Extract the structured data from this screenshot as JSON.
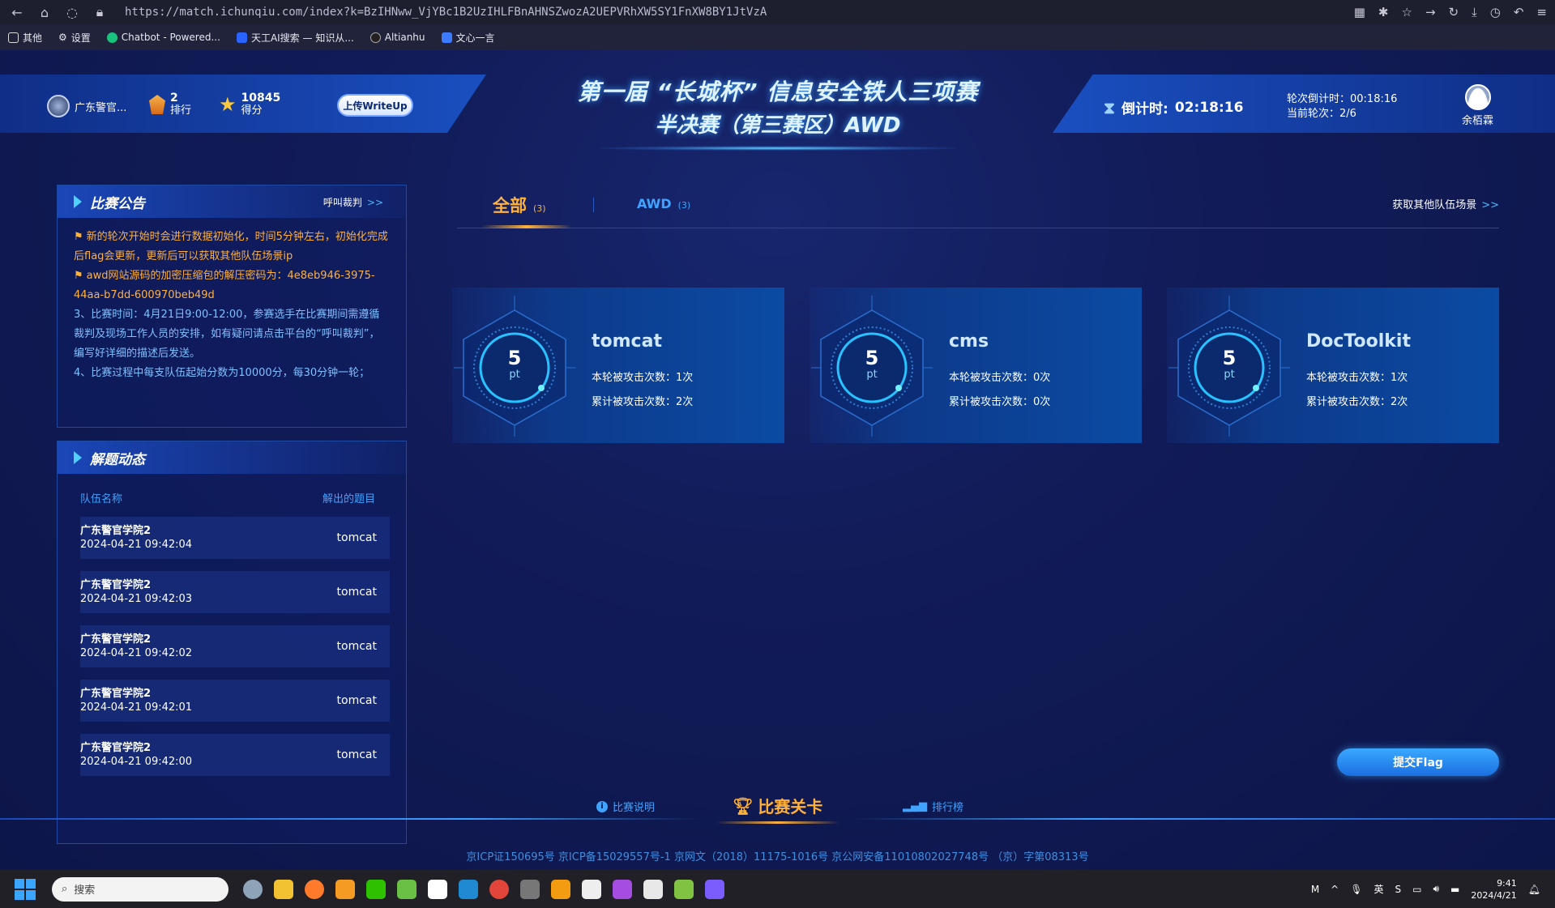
{
  "browser": {
    "url": "https://match.ichunqiu.com/index?k=BzIHNww_VjYBc1B2UzIHLFBnAHNSZwozA2UEPVRhXW5SY1FnXW8BY1JtVzA",
    "bookmarks": [
      "其他",
      "设置",
      "Chatbot - Powered...",
      "天工AI搜索 — 知识从...",
      "Altianhu",
      "文心一言"
    ]
  },
  "header": {
    "team_name": "广东警官...",
    "rank_value": "2",
    "rank_label": "排行",
    "score_value": "10845",
    "score_label": "得分",
    "writeup_button": "上传WriteUp",
    "title_line1": "第一届 “长城杯” 信息安全铁人三项赛",
    "title_line2": "半决赛（第三赛区）AWD",
    "countdown_label": "倒计时:",
    "countdown_value": "02:18:16",
    "round_countdown": "轮次倒计时：00:18:16",
    "current_round": "当前轮次：2/6",
    "username": "余栢霖"
  },
  "announcement": {
    "title": "比赛公告",
    "link": "呼叫裁判",
    "link_arrow": ">>",
    "items": [
      "新的轮次开始时会进行数据初始化，时间5分钟左右，初始化完成后flag会更新，更新后可以获取其他队伍场景ip",
      "awd网站源码的加密压缩包的解压密码为：4e8eb946-3975-44aa-b7dd-600970beb49d",
      "3、比赛时间：4月21日9:00-12:00，参赛选手在比赛期间需遵循裁判及现场工作人员的安排，如有疑问请点击平台的“呼叫裁判”，编写好详细的描述后发送。",
      "4、比赛过程中每支队伍起始分数为10000分，每30分钟一轮；"
    ]
  },
  "solves": {
    "title": "解题动态",
    "col_team": "队伍名称",
    "col_task": "解出的题目",
    "rows": [
      {
        "team": "广东警官学院2",
        "time": "2024-04-21 09:42:04",
        "task": "tomcat"
      },
      {
        "team": "广东警官学院2",
        "time": "2024-04-21 09:42:03",
        "task": "tomcat"
      },
      {
        "team": "广东警官学院2",
        "time": "2024-04-21 09:42:02",
        "task": "tomcat"
      },
      {
        "team": "广东警官学院2",
        "time": "2024-04-21 09:42:01",
        "task": "tomcat"
      },
      {
        "team": "广东警官学院2",
        "time": "2024-04-21 09:42:00",
        "task": "tomcat"
      }
    ]
  },
  "tabs": {
    "all_label": "全部",
    "all_count": "(3)",
    "awd_label": "AWD",
    "awd_count": "(3)",
    "other_scenes": "获取其他队伍场景",
    "other_arrow": ">>"
  },
  "challenges": [
    {
      "name": "tomcat",
      "points": "5",
      "unit": "pt",
      "round_attacks": "本轮被攻击次数：1次",
      "total_attacks": "累计被攻击次数：2次"
    },
    {
      "name": "cms",
      "points": "5",
      "unit": "pt",
      "round_attacks": "本轮被攻击次数：0次",
      "total_attacks": "累计被攻击次数：0次"
    },
    {
      "name": "DocToolkit",
      "points": "5",
      "unit": "pt",
      "round_attacks": "本轮被攻击次数：1次",
      "total_attacks": "累计被攻击次数：2次"
    }
  ],
  "submit_flag": "提交Flag",
  "bottom_nav": {
    "description": "比赛说明",
    "levels": "比赛关卡",
    "ranking": "排行榜"
  },
  "footer": "京ICP证150695号    京ICP备15029557号-1    京网文（2018）11175-1016号    京公网安备11010802027748号    （京）字第08313号",
  "taskbar": {
    "search_placeholder": "搜索",
    "ime": "英",
    "time": "9:41",
    "date": "2024/4/21"
  },
  "colors": {
    "accent_orange": "#ffb13a",
    "accent_blue": "#3fa3ff",
    "background": "#111b57"
  }
}
